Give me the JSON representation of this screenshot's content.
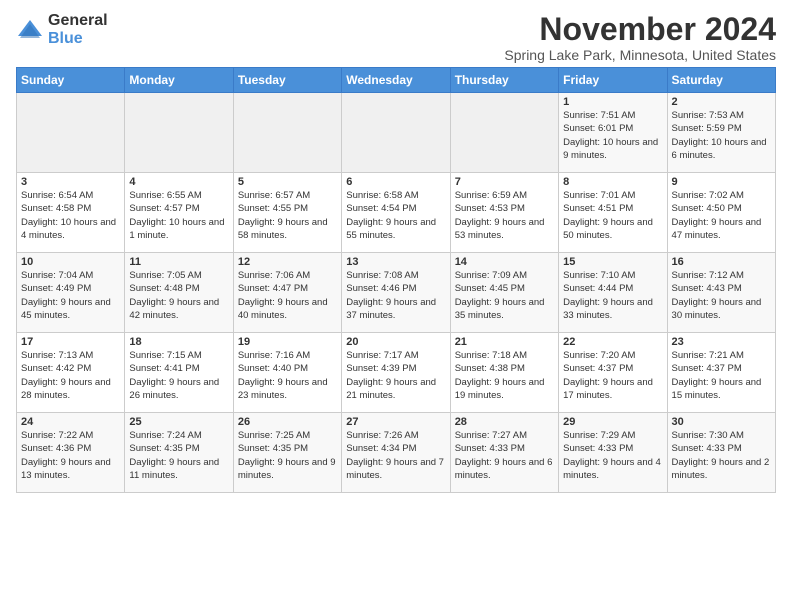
{
  "logo": {
    "general": "General",
    "blue": "Blue"
  },
  "title": "November 2024",
  "location": "Spring Lake Park, Minnesota, United States",
  "days_of_week": [
    "Sunday",
    "Monday",
    "Tuesday",
    "Wednesday",
    "Thursday",
    "Friday",
    "Saturday"
  ],
  "weeks": [
    [
      {
        "day": "",
        "info": ""
      },
      {
        "day": "",
        "info": ""
      },
      {
        "day": "",
        "info": ""
      },
      {
        "day": "",
        "info": ""
      },
      {
        "day": "",
        "info": ""
      },
      {
        "day": "1",
        "info": "Sunrise: 7:51 AM\nSunset: 6:01 PM\nDaylight: 10 hours\nand 9 minutes."
      },
      {
        "day": "2",
        "info": "Sunrise: 7:53 AM\nSunset: 5:59 PM\nDaylight: 10 hours\nand 6 minutes."
      }
    ],
    [
      {
        "day": "3",
        "info": "Sunrise: 6:54 AM\nSunset: 4:58 PM\nDaylight: 10 hours\nand 4 minutes."
      },
      {
        "day": "4",
        "info": "Sunrise: 6:55 AM\nSunset: 4:57 PM\nDaylight: 10 hours\nand 1 minute."
      },
      {
        "day": "5",
        "info": "Sunrise: 6:57 AM\nSunset: 4:55 PM\nDaylight: 9 hours\nand 58 minutes."
      },
      {
        "day": "6",
        "info": "Sunrise: 6:58 AM\nSunset: 4:54 PM\nDaylight: 9 hours\nand 55 minutes."
      },
      {
        "day": "7",
        "info": "Sunrise: 6:59 AM\nSunset: 4:53 PM\nDaylight: 9 hours\nand 53 minutes."
      },
      {
        "day": "8",
        "info": "Sunrise: 7:01 AM\nSunset: 4:51 PM\nDaylight: 9 hours\nand 50 minutes."
      },
      {
        "day": "9",
        "info": "Sunrise: 7:02 AM\nSunset: 4:50 PM\nDaylight: 9 hours\nand 47 minutes."
      }
    ],
    [
      {
        "day": "10",
        "info": "Sunrise: 7:04 AM\nSunset: 4:49 PM\nDaylight: 9 hours\nand 45 minutes."
      },
      {
        "day": "11",
        "info": "Sunrise: 7:05 AM\nSunset: 4:48 PM\nDaylight: 9 hours\nand 42 minutes."
      },
      {
        "day": "12",
        "info": "Sunrise: 7:06 AM\nSunset: 4:47 PM\nDaylight: 9 hours\nand 40 minutes."
      },
      {
        "day": "13",
        "info": "Sunrise: 7:08 AM\nSunset: 4:46 PM\nDaylight: 9 hours\nand 37 minutes."
      },
      {
        "day": "14",
        "info": "Sunrise: 7:09 AM\nSunset: 4:45 PM\nDaylight: 9 hours\nand 35 minutes."
      },
      {
        "day": "15",
        "info": "Sunrise: 7:10 AM\nSunset: 4:44 PM\nDaylight: 9 hours\nand 33 minutes."
      },
      {
        "day": "16",
        "info": "Sunrise: 7:12 AM\nSunset: 4:43 PM\nDaylight: 9 hours\nand 30 minutes."
      }
    ],
    [
      {
        "day": "17",
        "info": "Sunrise: 7:13 AM\nSunset: 4:42 PM\nDaylight: 9 hours\nand 28 minutes."
      },
      {
        "day": "18",
        "info": "Sunrise: 7:15 AM\nSunset: 4:41 PM\nDaylight: 9 hours\nand 26 minutes."
      },
      {
        "day": "19",
        "info": "Sunrise: 7:16 AM\nSunset: 4:40 PM\nDaylight: 9 hours\nand 23 minutes."
      },
      {
        "day": "20",
        "info": "Sunrise: 7:17 AM\nSunset: 4:39 PM\nDaylight: 9 hours\nand 21 minutes."
      },
      {
        "day": "21",
        "info": "Sunrise: 7:18 AM\nSunset: 4:38 PM\nDaylight: 9 hours\nand 19 minutes."
      },
      {
        "day": "22",
        "info": "Sunrise: 7:20 AM\nSunset: 4:37 PM\nDaylight: 9 hours\nand 17 minutes."
      },
      {
        "day": "23",
        "info": "Sunrise: 7:21 AM\nSunset: 4:37 PM\nDaylight: 9 hours\nand 15 minutes."
      }
    ],
    [
      {
        "day": "24",
        "info": "Sunrise: 7:22 AM\nSunset: 4:36 PM\nDaylight: 9 hours\nand 13 minutes."
      },
      {
        "day": "25",
        "info": "Sunrise: 7:24 AM\nSunset: 4:35 PM\nDaylight: 9 hours\nand 11 minutes."
      },
      {
        "day": "26",
        "info": "Sunrise: 7:25 AM\nSunset: 4:35 PM\nDaylight: 9 hours\nand 9 minutes."
      },
      {
        "day": "27",
        "info": "Sunrise: 7:26 AM\nSunset: 4:34 PM\nDaylight: 9 hours\nand 7 minutes."
      },
      {
        "day": "28",
        "info": "Sunrise: 7:27 AM\nSunset: 4:33 PM\nDaylight: 9 hours\nand 6 minutes."
      },
      {
        "day": "29",
        "info": "Sunrise: 7:29 AM\nSunset: 4:33 PM\nDaylight: 9 hours\nand 4 minutes."
      },
      {
        "day": "30",
        "info": "Sunrise: 7:30 AM\nSunset: 4:33 PM\nDaylight: 9 hours\nand 2 minutes."
      }
    ]
  ]
}
